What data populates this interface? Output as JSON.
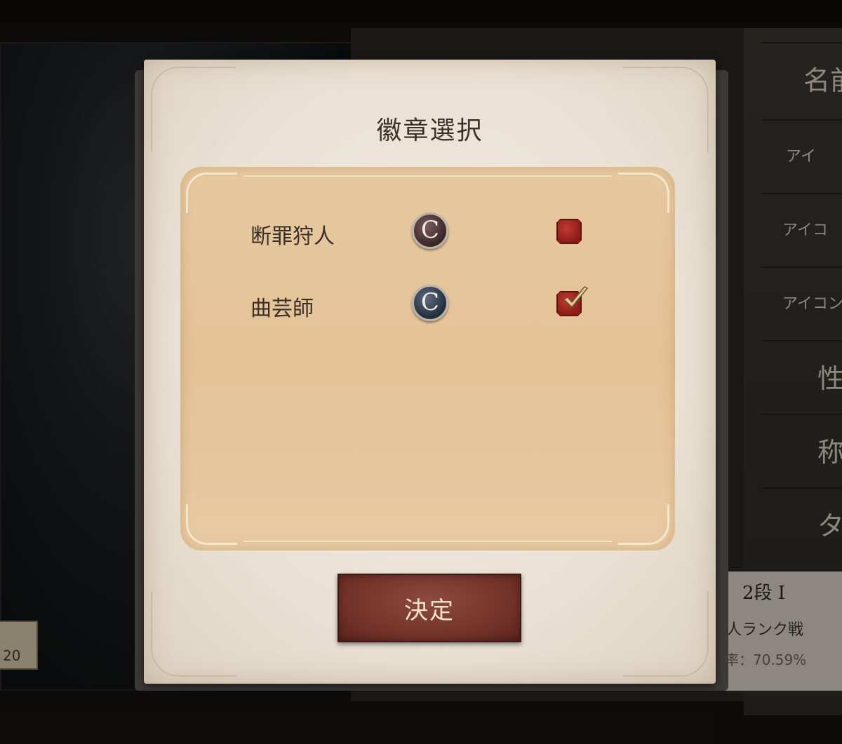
{
  "dialog": {
    "title": "徽章選択",
    "confirm_label": "決定",
    "badges": [
      {
        "name": "断罪狩人",
        "emblem_glyph": "C",
        "emblem_color": "#3a2628",
        "selected": false
      },
      {
        "name": "曲芸師",
        "emblem_glyph": "C",
        "emblem_color": "#222c3a",
        "selected": true
      }
    ]
  },
  "background": {
    "right_menu": [
      "名前",
      "アイ",
      "アイコ",
      "アイコン",
      "性",
      "称",
      "タ"
    ],
    "rank": "2段 I",
    "ranked_mode": "人ランク戦",
    "rate": "率：70.59%",
    "left_badge_value": "20"
  },
  "colors": {
    "dialog_bg": "#ece5da",
    "list_bg": "#e5c59a",
    "confirm_button": "#7c392f",
    "checkbox_red": "#b12e27",
    "check_gold": "#e2cf95"
  }
}
